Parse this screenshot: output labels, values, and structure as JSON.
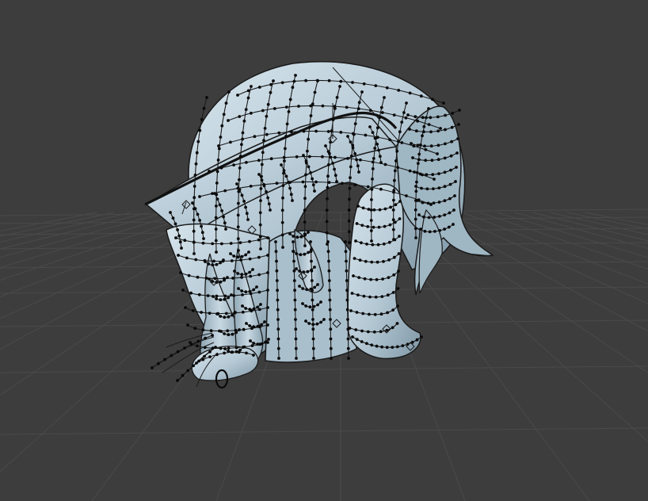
{
  "viewport": {
    "mode": "3d-edit-view",
    "shading": "solid-with-wireframe",
    "object": "hair-mesh",
    "grid": true
  },
  "colors": {
    "background": "#3d3d3d",
    "grid_line": "#4a4a4a",
    "mesh_fill": "#b4c8d4",
    "mesh_shadow": "#8aa2b0",
    "mesh_highlight": "#d6e4ec",
    "wire": "#1a1a1a",
    "vertex": "#0a0a0a"
  }
}
